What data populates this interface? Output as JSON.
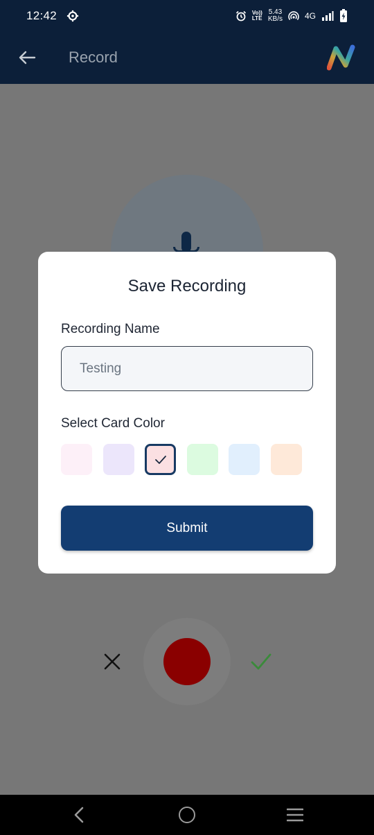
{
  "status_bar": {
    "time": "12:42",
    "speed_value": "5.43",
    "speed_unit": "KB/s",
    "volte_top": "Vo))",
    "volte_bottom": "LTE",
    "network": "4G",
    "icons": [
      "settings-icon",
      "alarm-icon",
      "hotspot-icon",
      "signal-icon",
      "battery-charging-icon"
    ]
  },
  "header": {
    "title": "Record",
    "back_icon": "back-arrow-icon",
    "logo": "brand-logo"
  },
  "dialog": {
    "title": "Save Recording",
    "name_label": "Recording Name",
    "name_value": "Testing",
    "color_label": "Select Card Color",
    "colors": [
      "#fdf0f8",
      "#ece6fb",
      "#fbe0e2",
      "#dcfbe0",
      "#e1effd",
      "#fee9d9"
    ],
    "selected_color_index": 2,
    "submit_label": "Submit"
  },
  "controls": {
    "cancel_icon": "close-icon",
    "record_icon": "record-button",
    "confirm_icon": "check-icon",
    "record_color": "#8a0000",
    "confirm_color": "#3a8a3a"
  },
  "colors": {
    "primary": "#133d72",
    "header_bg": "#0c1f39",
    "overlay": "#777777"
  }
}
